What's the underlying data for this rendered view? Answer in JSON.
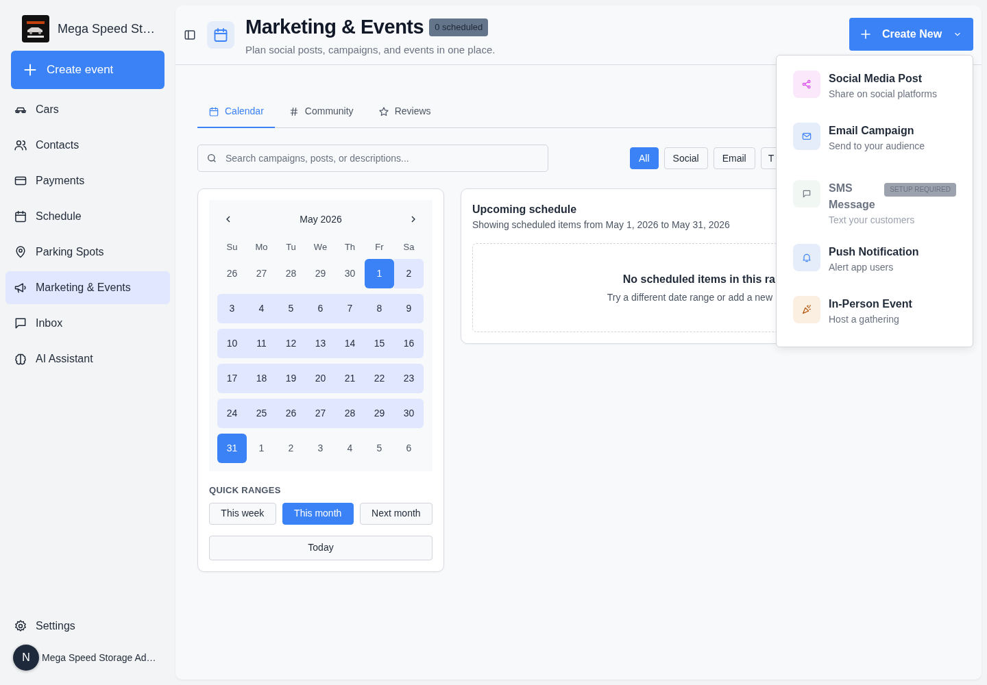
{
  "sidebar": {
    "brand": "Mega Speed St…",
    "create_button": "Create event",
    "items": [
      {
        "label": "Cars",
        "kind": "car",
        "selected": false
      },
      {
        "label": "Contacts",
        "kind": "people",
        "selected": false
      },
      {
        "label": "Payments",
        "kind": "card",
        "selected": false
      },
      {
        "label": "Schedule",
        "kind": "calendar",
        "selected": false
      },
      {
        "label": "Parking Spots",
        "kind": "pin",
        "selected": false
      },
      {
        "label": "Marketing & Events",
        "kind": "megaphone",
        "selected": true
      },
      {
        "label": "Inbox",
        "kind": "chat",
        "selected": false
      },
      {
        "label": "AI Assistant",
        "kind": "brain",
        "selected": false
      }
    ],
    "settings": "Settings",
    "user": {
      "avatar": "N",
      "name": "Mega Speed Storage Ad…"
    }
  },
  "header": {
    "title": "Marketing & Events",
    "badge": "0 scheduled",
    "subtitle": "Plan social posts, campaigns, and events in one place.",
    "create_button": "Create New"
  },
  "tabs": [
    {
      "label": "Calendar",
      "kind": "calendar",
      "selected": true
    },
    {
      "label": "Community",
      "kind": "hash",
      "selected": false
    },
    {
      "label": "Reviews",
      "kind": "star",
      "selected": false
    }
  ],
  "search": {
    "placeholder": "Search campaigns, posts, or descriptions..."
  },
  "filters": [
    {
      "label": "All",
      "selected": true
    },
    {
      "label": "Social",
      "selected": false
    },
    {
      "label": "Email",
      "selected": false
    },
    {
      "label": "T",
      "selected": false
    }
  ],
  "calendar": {
    "month": "May 2026",
    "weekdays": [
      "Su",
      "Mo",
      "Tu",
      "We",
      "Th",
      "Fr",
      "Sa"
    ],
    "weeks": [
      [
        {
          "day": "26",
          "kind": "outside"
        },
        {
          "day": "27",
          "kind": "outside"
        },
        {
          "day": "28",
          "kind": "outside"
        },
        {
          "day": "29",
          "kind": "outside"
        },
        {
          "day": "30",
          "kind": "outside"
        },
        {
          "day": "1",
          "kind": "endpoint"
        },
        {
          "day": "2",
          "kind": "range"
        }
      ],
      [
        {
          "day": "3",
          "kind": "range"
        },
        {
          "day": "4",
          "kind": "range"
        },
        {
          "day": "5",
          "kind": "range"
        },
        {
          "day": "6",
          "kind": "range"
        },
        {
          "day": "7",
          "kind": "range"
        },
        {
          "day": "8",
          "kind": "range"
        },
        {
          "day": "9",
          "kind": "range"
        }
      ],
      [
        {
          "day": "10",
          "kind": "range"
        },
        {
          "day": "11",
          "kind": "range"
        },
        {
          "day": "12",
          "kind": "range"
        },
        {
          "day": "13",
          "kind": "range"
        },
        {
          "day": "14",
          "kind": "range"
        },
        {
          "day": "15",
          "kind": "range"
        },
        {
          "day": "16",
          "kind": "range"
        }
      ],
      [
        {
          "day": "17",
          "kind": "range"
        },
        {
          "day": "18",
          "kind": "range"
        },
        {
          "day": "19",
          "kind": "range"
        },
        {
          "day": "20",
          "kind": "range"
        },
        {
          "day": "21",
          "kind": "range"
        },
        {
          "day": "22",
          "kind": "range"
        },
        {
          "day": "23",
          "kind": "range"
        }
      ],
      [
        {
          "day": "24",
          "kind": "range"
        },
        {
          "day": "25",
          "kind": "range"
        },
        {
          "day": "26",
          "kind": "range"
        },
        {
          "day": "27",
          "kind": "range"
        },
        {
          "day": "28",
          "kind": "range"
        },
        {
          "day": "29",
          "kind": "range"
        },
        {
          "day": "30",
          "kind": "range"
        }
      ],
      [
        {
          "day": "31",
          "kind": "endpoint"
        },
        {
          "day": "1",
          "kind": "outside"
        },
        {
          "day": "2",
          "kind": "outside"
        },
        {
          "day": "3",
          "kind": "outside"
        },
        {
          "day": "4",
          "kind": "outside"
        },
        {
          "day": "5",
          "kind": "outside"
        },
        {
          "day": "6",
          "kind": "outside"
        }
      ]
    ]
  },
  "quick_ranges": {
    "title": "QUICK RANGES",
    "buttons": [
      {
        "label": "This week",
        "selected": false
      },
      {
        "label": "This month",
        "selected": true
      },
      {
        "label": "Next month",
        "selected": false
      }
    ],
    "today": "Today"
  },
  "schedule": {
    "title": "Upcoming schedule",
    "subtitle": "Showing scheduled items from May 1, 2026 to May 31, 2026",
    "empty_title": "No scheduled items in this ra",
    "empty_text": "Try a different date range or add a new"
  },
  "menu": [
    {
      "title": "Social Media Post",
      "subtitle": "Share on social platforms",
      "kind": "social",
      "disabled": false
    },
    {
      "title": "Email Campaign",
      "subtitle": "Send to your audience",
      "kind": "email",
      "disabled": false
    },
    {
      "title": "SMS Message",
      "subtitle": "Text your customers",
      "kind": "sms",
      "disabled": true,
      "badge": "SETUP REQUIRED"
    },
    {
      "title": "Push Notification",
      "subtitle": "Alert app users",
      "kind": "push",
      "disabled": false
    },
    {
      "title": "In-Person Event",
      "subtitle": "Host a gathering",
      "kind": "event",
      "disabled": false
    }
  ]
}
